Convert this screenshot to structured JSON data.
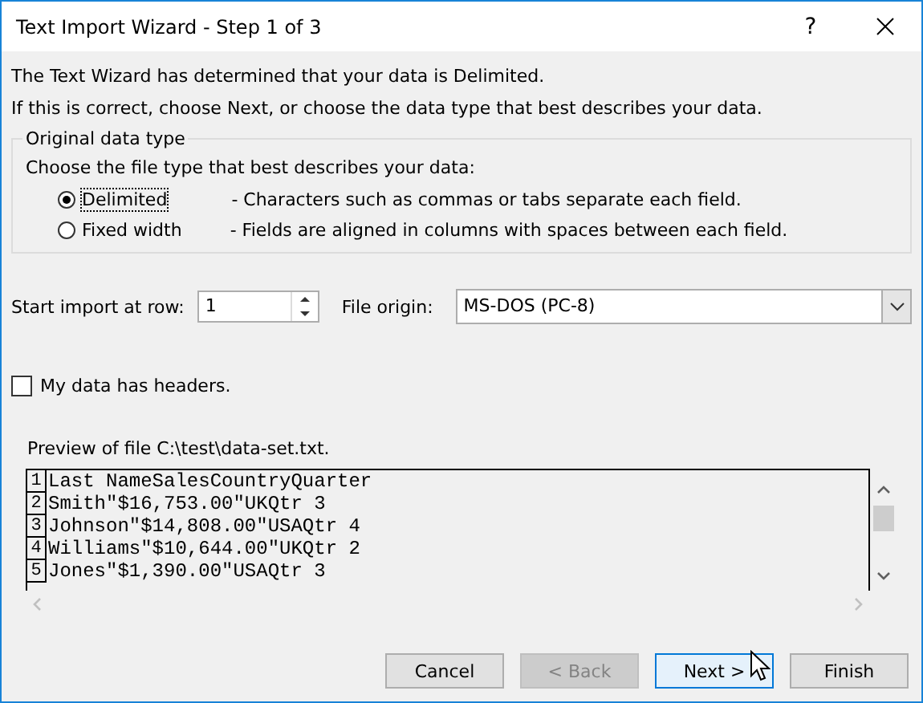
{
  "window": {
    "title": "Text Import Wizard - Step 1 of 3",
    "help": "?"
  },
  "intro": [
    "The Text Wizard has determined that your data is Delimited.",
    "If this is correct, choose Next, or choose the data type that best describes your data."
  ],
  "data_type": {
    "legend": "Original data type",
    "prompt": "Choose the file type that best describes your data:",
    "options": [
      {
        "label": "Delimited",
        "description": "- Characters such as commas or tabs separate each field.",
        "selected": true
      },
      {
        "label": "Fixed width",
        "description": "- Fields are aligned in columns with spaces between each field.",
        "selected": false
      }
    ]
  },
  "start_row": {
    "label": "Start import at row:",
    "value": "1"
  },
  "file_origin": {
    "label": "File origin:",
    "value": "MS-DOS (PC-8)"
  },
  "headers": {
    "label": "My data has headers.",
    "checked": false
  },
  "preview": {
    "label": "Preview of file C:\\test\\data-set.txt.",
    "rows": [
      {
        "number": "1",
        "text": "Last NameSalesCountryQuarter"
      },
      {
        "number": "2",
        "text": "Smith\"$16,753.00\"UKQtr 3"
      },
      {
        "number": "3",
        "text": "Johnson\"$14,808.00\"USAQtr 4"
      },
      {
        "number": "4",
        "text": "Williams\"$10,644.00\"UKQtr 2"
      },
      {
        "number": "5",
        "text": "Jones\"$1,390.00\"USAQtr 3"
      }
    ]
  },
  "buttons": [
    {
      "label": "Cancel",
      "disabled": false,
      "default": false
    },
    {
      "label": "< Back",
      "disabled": true,
      "default": false
    },
    {
      "label": "Next >",
      "disabled": false,
      "default": true
    },
    {
      "label": "Finish",
      "disabled": false,
      "default": false
    }
  ]
}
